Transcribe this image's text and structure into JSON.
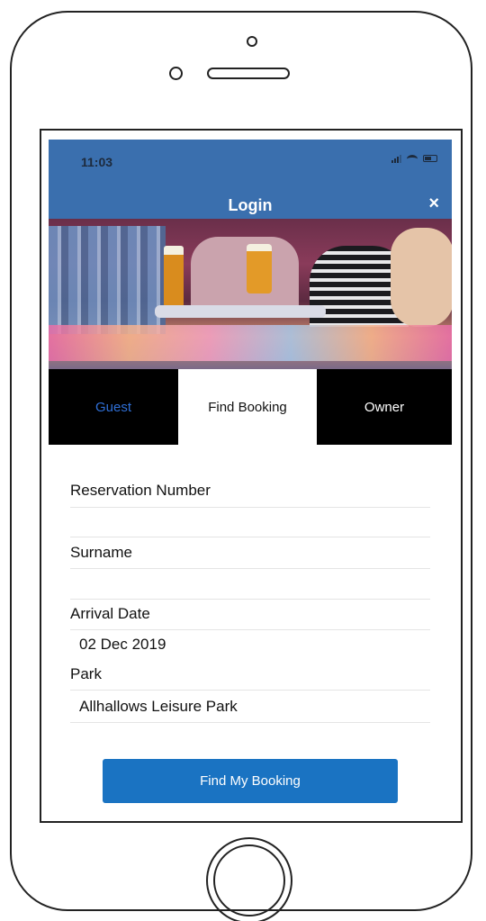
{
  "status_bar": {
    "time": "11:03"
  },
  "header": {
    "title": "Login",
    "close_label": "×",
    "background_color": "#3a6fae"
  },
  "hero": {
    "image": "people-at-bar-with-beers"
  },
  "tabs": [
    {
      "label": "Guest",
      "active": false,
      "color": "#2f6fd6"
    },
    {
      "label": "Find Booking",
      "active": true
    },
    {
      "label": "Owner",
      "active": false
    }
  ],
  "form": {
    "reservation_number": {
      "label": "Reservation Number",
      "value": ""
    },
    "surname": {
      "label": "Surname",
      "value": ""
    },
    "arrival_date": {
      "label": "Arrival Date",
      "value": "02 Dec 2019"
    },
    "park": {
      "label": "Park",
      "value": "Allhallows Leisure Park"
    }
  },
  "submit_button": {
    "label": "Find My Booking",
    "color": "#1a73c2"
  }
}
